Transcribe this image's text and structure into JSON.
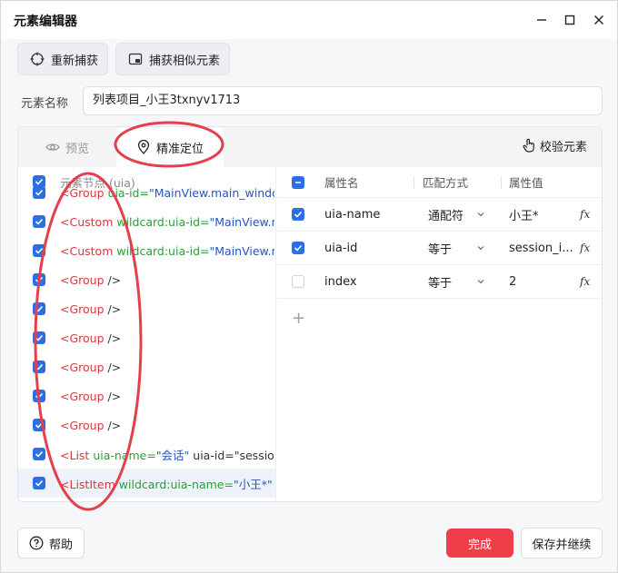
{
  "window": {
    "title": "元素编辑器"
  },
  "toolbar": {
    "recapture_label": "重新捕获",
    "capture_similar_label": "捕获相似元素"
  },
  "element_name": {
    "label": "元素名称",
    "value": "列表项目_小王3txnyv1713"
  },
  "tabs": {
    "preview_label": "预览",
    "locate_label": "精准定位",
    "verify_label": "校验元素"
  },
  "tree": {
    "header": "元素节点 (uia)",
    "rows": [
      {
        "checked": true,
        "br": "<",
        "tag": "Group",
        "attr": " uia-id=",
        "val": "\"MainView.main_windo",
        "end": ""
      },
      {
        "checked": true,
        "br": "<",
        "tag": "Custom",
        "attr": " wildcard:uia-id=",
        "val": "\"MainView.m",
        "end": ""
      },
      {
        "checked": true,
        "br": "<",
        "tag": "Custom",
        "attr": " wildcard:uia-id=",
        "val": "\"MainView.m",
        "end": ""
      },
      {
        "checked": true,
        "br": "<",
        "tag": "Group",
        "attr": "",
        "val": "",
        "end": " />"
      },
      {
        "checked": true,
        "br": "<",
        "tag": "Group",
        "attr": "",
        "val": "",
        "end": " />"
      },
      {
        "checked": true,
        "br": "<",
        "tag": "Group",
        "attr": "",
        "val": "",
        "end": " />"
      },
      {
        "checked": true,
        "br": "<",
        "tag": "Group",
        "attr": "",
        "val": "",
        "end": " />"
      },
      {
        "checked": true,
        "br": "<",
        "tag": "Group",
        "attr": "",
        "val": "",
        "end": " />"
      },
      {
        "checked": true,
        "br": "<",
        "tag": "Group",
        "attr": "",
        "val": "",
        "end": " />"
      },
      {
        "checked": true,
        "br": "<",
        "tag": "List",
        "attr": " uia-name=",
        "val": "\"会话\"",
        "end": " uia-id=\"session"
      },
      {
        "checked": true,
        "br": "<",
        "tag": "ListItem",
        "attr": " wildcard:uia-name=",
        "val": "\"小王*\"",
        "end": " ui"
      }
    ]
  },
  "attributes": {
    "headers": {
      "name": "属性名",
      "match": "匹配方式",
      "value": "属性值"
    },
    "rows": [
      {
        "checked": true,
        "name": "uia-name",
        "match": "通配符",
        "value": "小王*",
        "fx": "fx"
      },
      {
        "checked": true,
        "name": "uia-id",
        "match": "等于",
        "value": "session_i...",
        "fx": "fx"
      },
      {
        "checked": false,
        "name": "index",
        "match": "等于",
        "value": "2",
        "fx": "fx"
      }
    ],
    "add_symbol": "+"
  },
  "footer": {
    "help_label": "帮助",
    "done_label": "完成",
    "save_continue_label": "保存并继续"
  },
  "colors": {
    "accent_blue": "#2a6ee8",
    "done_red": "#ef3e4a",
    "annotation_red": "#e53e4c",
    "tag_red": "#d13b3b",
    "attr_green": "#2a9d3a",
    "value_blue": "#2453c2"
  }
}
